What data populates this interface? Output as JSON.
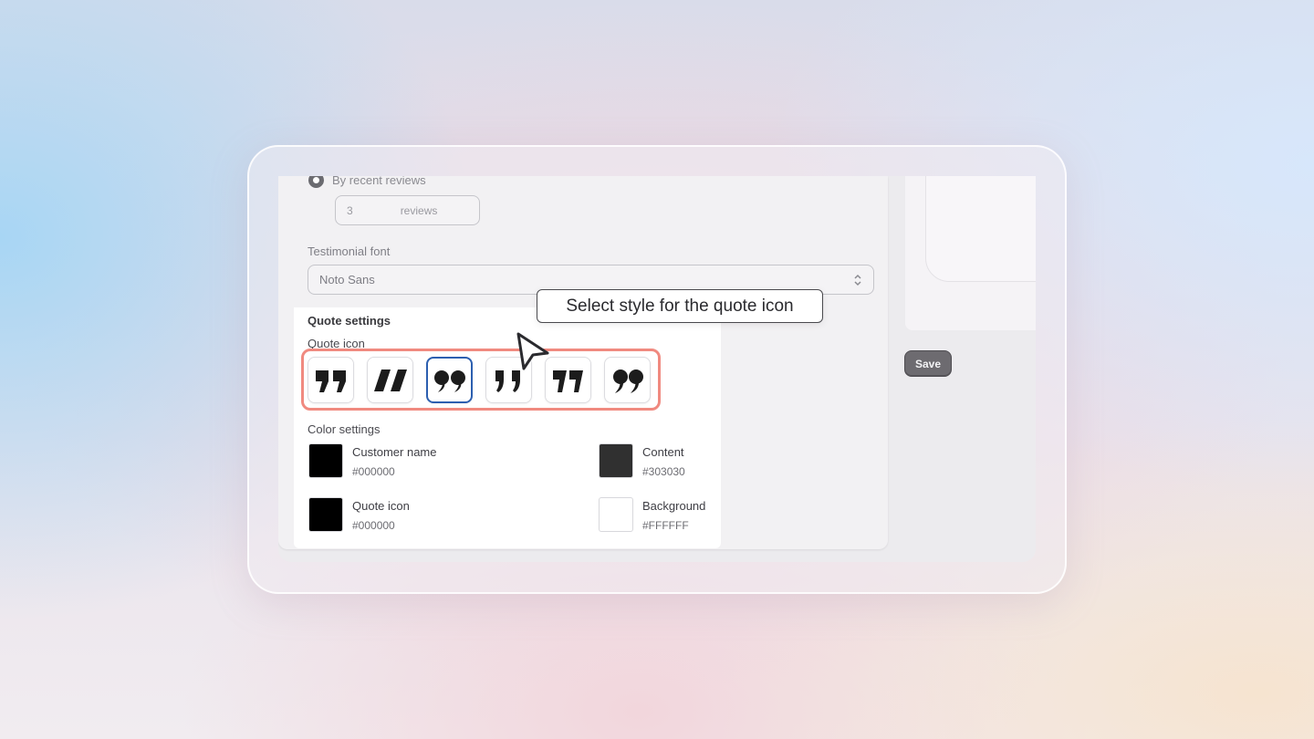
{
  "review_source": {
    "radio_label": "By recent reviews",
    "count_value": "3",
    "count_suffix": "reviews"
  },
  "font_setting": {
    "label": "Testimonial font",
    "selected": "Noto Sans"
  },
  "quote_settings": {
    "title": "Quote settings",
    "icon_label": "Quote icon",
    "styles": [
      {
        "icon": "quote-style-1-icon",
        "selected": false
      },
      {
        "icon": "quote-style-2-icon",
        "selected": false
      },
      {
        "icon": "quote-style-3-icon",
        "selected": true
      },
      {
        "icon": "quote-style-4-icon",
        "selected": false
      },
      {
        "icon": "quote-style-5-icon",
        "selected": false
      },
      {
        "icon": "quote-style-6-icon",
        "selected": false
      }
    ]
  },
  "color_settings": {
    "title": "Color settings",
    "items": [
      {
        "name": "Customer name",
        "hex": "#000000"
      },
      {
        "name": "Content",
        "hex": "#303030"
      },
      {
        "name": "Quote icon",
        "hex": "#000000"
      },
      {
        "name": "Background",
        "hex": "#FFFFFF"
      }
    ]
  },
  "tooltip": {
    "text": "Select style for the quote icon"
  },
  "actions": {
    "save_label": "Save"
  },
  "colors": {
    "highlight": "#f08a80",
    "selected_border": "#2c5fb0",
    "save_bg": "#6d6b70"
  }
}
